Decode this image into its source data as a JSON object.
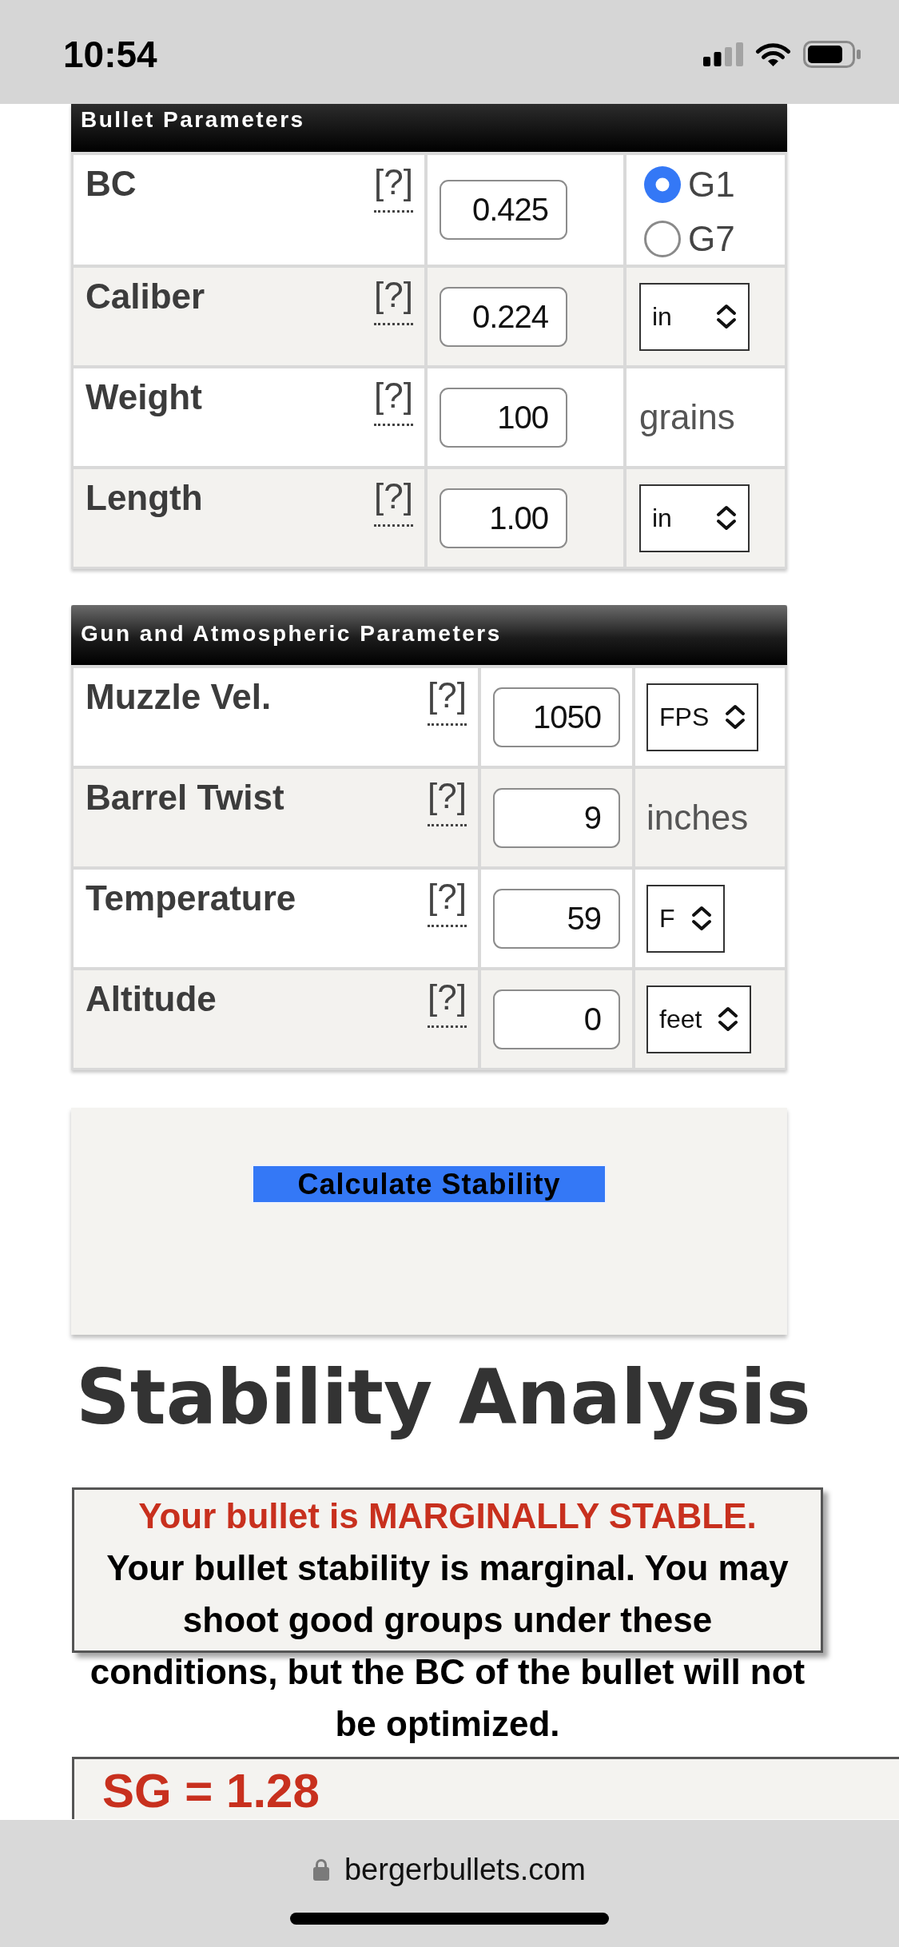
{
  "status_bar": {
    "time": "10:54"
  },
  "sections": [
    {
      "title": "Bullet Parameters",
      "rows": [
        {
          "label": "BC",
          "help": "[?]",
          "value": "0.425",
          "unit": {
            "kind": "radio",
            "options": [
              {
                "label": "G1",
                "selected": true
              },
              {
                "label": "G7",
                "selected": false
              }
            ]
          }
        },
        {
          "label": "Caliber",
          "help": "[?]",
          "value": "0.224",
          "unit": {
            "kind": "select",
            "value": "in"
          }
        },
        {
          "label": "Weight",
          "help": "[?]",
          "value": "100",
          "unit": {
            "kind": "text",
            "text": "grains"
          }
        },
        {
          "label": "Length",
          "help": "[?]",
          "value": "1.00",
          "unit": {
            "kind": "select",
            "value": "in"
          }
        }
      ]
    },
    {
      "title": "Gun and Atmospheric Parameters",
      "rows": [
        {
          "label": "Muzzle Vel.",
          "help": "[?]",
          "value": "1050",
          "unit": {
            "kind": "select",
            "value": "FPS"
          }
        },
        {
          "label": "Barrel Twist",
          "help": "[?]",
          "value": "9",
          "unit": {
            "kind": "text",
            "text": "inches"
          }
        },
        {
          "label": "Temperature",
          "help": "[?]",
          "value": "59",
          "unit": {
            "kind": "select",
            "value": "F"
          }
        },
        {
          "label": "Altitude",
          "help": "[?]",
          "value": "0",
          "unit": {
            "kind": "select",
            "value": "feet"
          }
        }
      ]
    }
  ],
  "calculate_button": {
    "label": "Calculate Stability"
  },
  "heading": "Stability Analysis",
  "result": {
    "status": "Your bullet is MARGINALLY STABLE.",
    "message": "Your bullet stability is marginal. You may shoot good groups under these conditions, but the BC of the bullet will not be optimized.",
    "sg": "SG = 1.28"
  },
  "browser_bar": {
    "url": "bergerbullets.com"
  }
}
